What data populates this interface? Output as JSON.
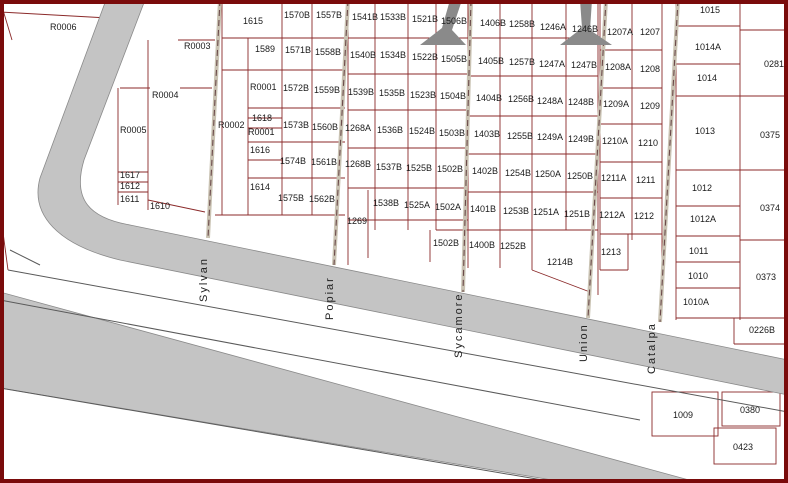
{
  "colors": {
    "frame": "#7a0b0b",
    "parcel_line": "#8b2a2a",
    "road_fill": "#c4c4c4",
    "alley_fill": "#c9c2b2",
    "background": "#ffffff"
  },
  "streets": [
    "Sylvan",
    "Popiar",
    "Sycamore",
    "Union",
    "Catalpa"
  ],
  "lots": [
    "R0006",
    "1615",
    "1570B",
    "1557B",
    "1541B",
    "1533B",
    "1521B",
    "1506B",
    "1406B",
    "1258B",
    "1246A",
    "1246B",
    "1207A",
    "1207",
    "1015",
    "R0003",
    "1589",
    "1571B",
    "1558B",
    "1540B",
    "1534B",
    "1522B",
    "1505B",
    "1405B",
    "1257B",
    "1247A",
    "1247B",
    "1208A",
    "1208",
    "1014A",
    "0281",
    "R0004",
    "R0001",
    "1572B",
    "1559B",
    "1539B",
    "1535B",
    "1523B",
    "1504B",
    "1404B",
    "1256B",
    "1248A",
    "1248B",
    "1209A",
    "1209",
    "1014",
    "R0005",
    "R0002",
    "1618",
    "R0001",
    "1573B",
    "1560B",
    "1268A",
    "1536B",
    "1524B",
    "1503B",
    "1403B",
    "1255B",
    "1249A",
    "1249B",
    "1210A",
    "1210",
    "1013",
    "0375",
    "1616",
    "1574B",
    "1561B",
    "1268B",
    "1537B",
    "1525B",
    "1502B",
    "1402B",
    "1254B",
    "1250A",
    "1250B",
    "1211A",
    "1211",
    "1617",
    "1612",
    "1611",
    "1610",
    "1614",
    "1575B",
    "1562B",
    "1269",
    "1538B",
    "1525A",
    "1502A",
    "1401B",
    "1253B",
    "1251A",
    "1251B",
    "1212A",
    "1212",
    "1012",
    "1012A",
    "0374",
    "1502B",
    "1400B",
    "1252B",
    "1214B",
    "1213",
    "1011",
    "1010",
    "0373",
    "1010A",
    "0226B",
    "1009",
    "0380",
    "0423"
  ]
}
